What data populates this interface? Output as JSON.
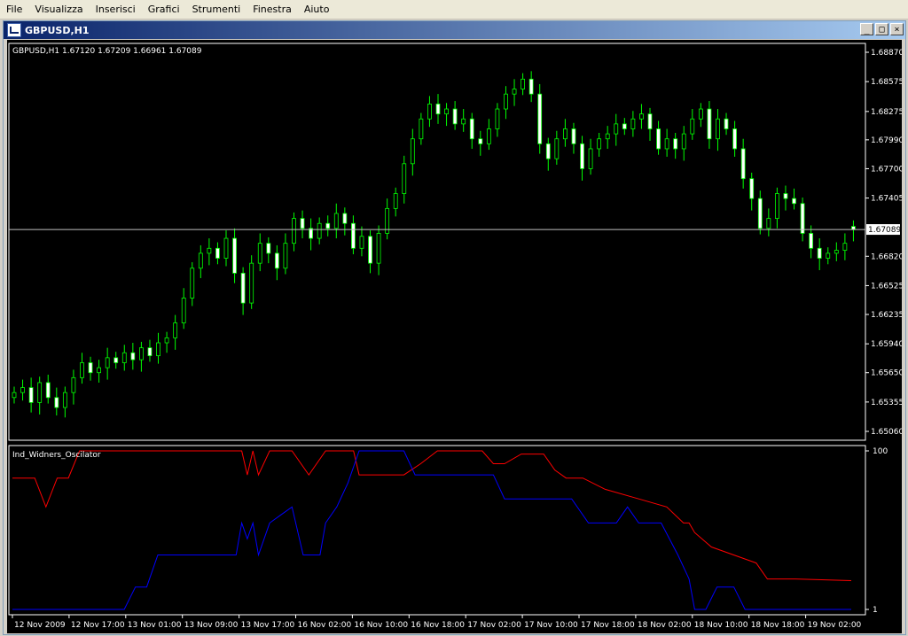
{
  "menu": [
    {
      "id": "file",
      "label": "File"
    },
    {
      "id": "visualizza",
      "label": "Visualizza"
    },
    {
      "id": "inserisci",
      "label": "Inserisci"
    },
    {
      "id": "grafici",
      "label": "Grafici"
    },
    {
      "id": "strumenti",
      "label": "Strumenti"
    },
    {
      "id": "finestra",
      "label": "Finestra"
    },
    {
      "id": "aiuto",
      "label": "Aiuto"
    }
  ],
  "window": {
    "title": "GBPUSD,H1",
    "minimize_glyph": "_",
    "maximize_glyph": "□",
    "close_glyph": "×"
  },
  "colors": {
    "chart_bg": "#000000",
    "candle": "#00ff00",
    "bull_body": "#000000",
    "bear_body": "#ffffff",
    "price_line": "#c0c0c0",
    "osc_red": "#ff0000",
    "osc_blue": "#0000ff",
    "axis": "#ffffff"
  },
  "chart_data": [
    {
      "type": "candlestick",
      "title": "GBPUSD,H1  1.67120 1.67209 1.66961 1.67089",
      "symbol": "GBPUSD,H1",
      "ohlc_text": "1.67120 1.67209 1.66961 1.67089",
      "ylim": [
        1.6506,
        1.6887
      ],
      "y_ticks": [
        "1.68870",
        "1.68575",
        "1.68275",
        "1.67990",
        "1.67700",
        "1.67405",
        "1.67089",
        "1.66820",
        "1.66525",
        "1.66235",
        "1.65940",
        "1.65650",
        "1.65355",
        "1.65060"
      ],
      "current_price": 1.67089,
      "current_price_label": "1.67089",
      "grid": false,
      "close": [
        1.6545,
        1.655,
        1.6535,
        1.6555,
        1.654,
        1.653,
        1.6545,
        1.656,
        1.6575,
        1.6565,
        1.657,
        1.658,
        1.6575,
        1.6585,
        1.6578,
        1.659,
        1.6582,
        1.6595,
        1.66,
        1.6615,
        1.664,
        1.667,
        1.6685,
        1.669,
        1.668,
        1.67,
        1.6665,
        1.6635,
        1.6675,
        1.6695,
        1.6685,
        1.667,
        1.6695,
        1.672,
        1.671,
        1.67,
        1.6715,
        1.671,
        1.6725,
        1.6715,
        1.669,
        1.6702,
        1.6675,
        1.6705,
        1.673,
        1.6745,
        1.6775,
        1.68,
        1.682,
        1.6835,
        1.6825,
        1.683,
        1.6815,
        1.682,
        1.68,
        1.6795,
        1.681,
        1.683,
        1.6845,
        1.685,
        1.686,
        1.6845,
        1.6795,
        1.678,
        1.68,
        1.681,
        1.6795,
        1.677,
        1.679,
        1.68,
        1.6805,
        1.6815,
        1.681,
        1.682,
        1.6825,
        1.681,
        1.679,
        1.68,
        1.679,
        1.6805,
        1.682,
        1.683,
        1.68,
        1.682,
        1.681,
        1.679,
        1.676,
        1.674,
        1.671,
        1.672,
        1.6745,
        1.674,
        1.6735,
        1.6705,
        1.669,
        1.668,
        1.6685,
        1.6688,
        1.6695,
        1.6709
      ],
      "open": [
        1.654,
        1.6545,
        1.655,
        1.6535,
        1.6555,
        1.654,
        1.653,
        1.6545,
        1.656,
        1.6575,
        1.6565,
        1.657,
        1.658,
        1.6575,
        1.6585,
        1.6578,
        1.659,
        1.6582,
        1.6595,
        1.66,
        1.6615,
        1.664,
        1.667,
        1.6685,
        1.669,
        1.668,
        1.67,
        1.6665,
        1.6635,
        1.6675,
        1.6695,
        1.6685,
        1.667,
        1.6695,
        1.672,
        1.671,
        1.67,
        1.6715,
        1.671,
        1.6725,
        1.6715,
        1.669,
        1.6702,
        1.6675,
        1.6705,
        1.673,
        1.6745,
        1.6775,
        1.68,
        1.682,
        1.6835,
        1.6825,
        1.683,
        1.6815,
        1.682,
        1.68,
        1.6795,
        1.681,
        1.683,
        1.6845,
        1.685,
        1.686,
        1.6845,
        1.6795,
        1.678,
        1.68,
        1.681,
        1.6795,
        1.677,
        1.679,
        1.68,
        1.6805,
        1.6815,
        1.681,
        1.682,
        1.6825,
        1.681,
        1.679,
        1.68,
        1.679,
        1.6805,
        1.682,
        1.683,
        1.68,
        1.682,
        1.681,
        1.679,
        1.676,
        1.674,
        1.671,
        1.672,
        1.6745,
        1.674,
        1.6735,
        1.6705,
        1.669,
        1.668,
        1.6685,
        1.6688,
        1.6712
      ]
    },
    {
      "type": "line",
      "title": "Ind_Widners_Oscilator",
      "ylim": [
        1,
        100
      ],
      "y_ticks": [
        "100",
        "1"
      ],
      "x_ticks": [
        "12 Nov 2009",
        "12 Nov 17:00",
        "13 Nov 01:00",
        "13 Nov 09:00",
        "13 Nov 17:00",
        "16 Nov 02:00",
        "16 Nov 10:00",
        "16 Nov 18:00",
        "17 Nov 02:00",
        "17 Nov 10:00",
        "17 Nov 18:00",
        "18 Nov 02:00",
        "18 Nov 10:00",
        "18 Nov 18:00",
        "19 Nov 02:00"
      ],
      "series": [
        {
          "color": "#ff0000",
          "points": [
            [
              0,
              83
            ],
            [
              4,
              83
            ],
            [
              6,
              65
            ],
            [
              8,
              83
            ],
            [
              10,
              83
            ],
            [
              12,
              100
            ],
            [
              14,
              100
            ],
            [
              20,
              100
            ],
            [
              24,
              100
            ],
            [
              30,
              100
            ],
            [
              38,
              100
            ],
            [
              41,
              100
            ],
            [
              42,
              85
            ],
            [
              43,
              100
            ],
            [
              44,
              85
            ],
            [
              46,
              100
            ],
            [
              50,
              100
            ],
            [
              53,
              85
            ],
            [
              56,
              100
            ],
            [
              61,
              100
            ],
            [
              62,
              85
            ],
            [
              66,
              85
            ],
            [
              70,
              85
            ],
            [
              73,
              92
            ],
            [
              76,
              100
            ],
            [
              84,
              100
            ],
            [
              86,
              92
            ],
            [
              88,
              92
            ],
            [
              91,
              98
            ],
            [
              95,
              98
            ],
            [
              97,
              88
            ],
            [
              99,
              83
            ],
            [
              102,
              83
            ],
            [
              106,
              76
            ],
            [
              112,
              70
            ],
            [
              117,
              65
            ],
            [
              120,
              55
            ],
            [
              121,
              55
            ],
            [
              122,
              49
            ],
            [
              125,
              40
            ],
            [
              133,
              30
            ],
            [
              135,
              20
            ],
            [
              140,
              20
            ],
            [
              150,
              19
            ]
          ]
        },
        {
          "color": "#0000ff",
          "points": [
            [
              0,
              1
            ],
            [
              20,
              1
            ],
            [
              22,
              15
            ],
            [
              24,
              15
            ],
            [
              26,
              35
            ],
            [
              30,
              35
            ],
            [
              40,
              35
            ],
            [
              41,
              55
            ],
            [
              42,
              45
            ],
            [
              43,
              55
            ],
            [
              44,
              35
            ],
            [
              46,
              55
            ],
            [
              48,
              60
            ],
            [
              50,
              65
            ],
            [
              52,
              35
            ],
            [
              55,
              35
            ],
            [
              56,
              55
            ],
            [
              58,
              65
            ],
            [
              60,
              80
            ],
            [
              62,
              100
            ],
            [
              70,
              100
            ],
            [
              72,
              85
            ],
            [
              80,
              85
            ],
            [
              86,
              85
            ],
            [
              88,
              70
            ],
            [
              94,
              70
            ],
            [
              100,
              70
            ],
            [
              103,
              55
            ],
            [
              108,
              55
            ],
            [
              110,
              65
            ],
            [
              112,
              55
            ],
            [
              116,
              55
            ],
            [
              119,
              35
            ],
            [
              121,
              20
            ],
            [
              122,
              1
            ],
            [
              124,
              1
            ],
            [
              126,
              15
            ],
            [
              129,
              15
            ],
            [
              131,
              1
            ],
            [
              150,
              1
            ]
          ]
        }
      ]
    }
  ]
}
